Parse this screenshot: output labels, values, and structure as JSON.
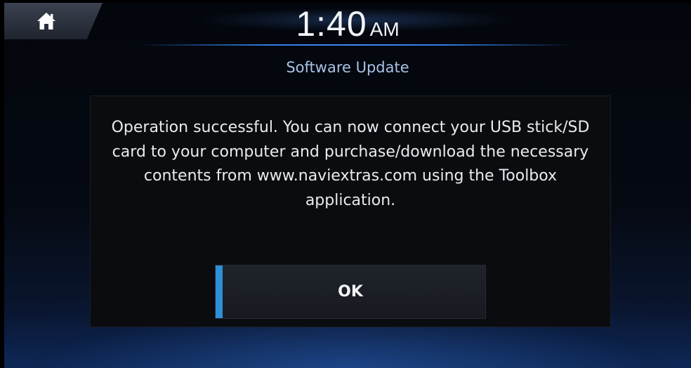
{
  "header": {
    "home_icon": "home-icon",
    "time": "1:40",
    "ampm": "AM"
  },
  "screen": {
    "title": "Software Update"
  },
  "dialog": {
    "message": "Operation successful. You can now connect your USB stick/SD card to your computer and purchase/download the necessary contents from www.naviextras.com using the Toolbox application.",
    "ok_label": "OK"
  },
  "colors": {
    "accent": "#2f8fd8",
    "title_text": "#a8c2e6",
    "clock_line": "#2f7fe6"
  }
}
